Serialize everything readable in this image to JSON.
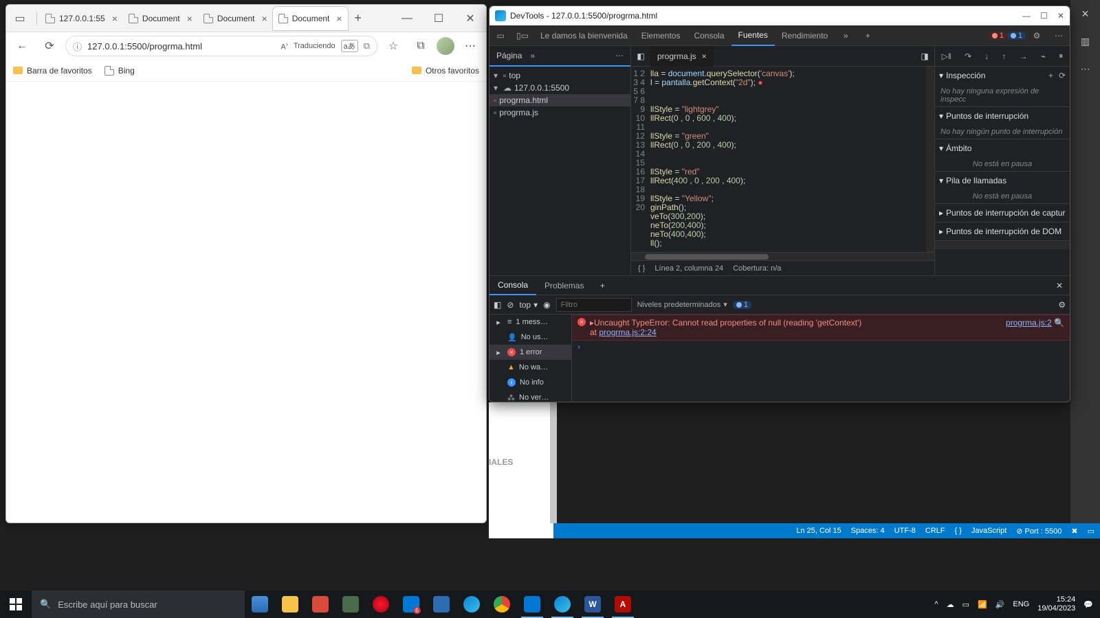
{
  "edge": {
    "tabs": [
      {
        "title": "127.0.0.1:55"
      },
      {
        "title": "Document"
      },
      {
        "title": "Document"
      },
      {
        "title": "Document"
      }
    ],
    "url": "127.0.0.1:5500/progrma.html",
    "translate": "Traduciendo",
    "favbar": {
      "title": "Barra de favoritos",
      "bing": "Bing",
      "other": "Otros favoritos"
    }
  },
  "leaked": "IALES",
  "devtools": {
    "title": "DevTools - 127.0.0.1:5500/progrma.html",
    "toptabs": {
      "welcome": "Le damos la bienvenida",
      "elements": "Elementos",
      "console": "Consola",
      "sources": "Fuentes",
      "perf": "Rendimiento"
    },
    "err_count": "1",
    "issue_count": "1",
    "leftpane": {
      "pagina": "Página",
      "top": "top",
      "host": "127.0.0.1:5500",
      "files": [
        "progrma.html",
        "progrma.js"
      ]
    },
    "src": {
      "file": "progrma.js",
      "lines": [
        "lla = document.querySelector('canvas');",
        "l = pantalla.getContext(\"2d\");",
        "",
        "",
        "llStyle = \"lightgrey\"",
        "llRect(0 , 0 , 600 , 400);",
        "",
        "llStyle = \"green\"",
        "llRect(0 , 0 , 200 , 400);",
        "",
        "",
        "llStyle = \"red\"",
        "llRect(400 , 0 , 200 , 400);",
        "",
        "llStyle = \"Yellow\";",
        "ginPath();",
        "veTo(300,200);",
        "neTo(200,400);",
        "neTo(400,400);",
        "ll();"
      ],
      "status_line": "Línea 2, columna 24",
      "coverage": "Cobertura: n/a"
    },
    "right": {
      "inspect": "Inspección",
      "inspect_empty": "No hay ninguna expresión de inspecc",
      "breakpoints": "Puntos de interrupción",
      "bp_empty": "No hay ningún punto de interrupción",
      "scope": "Ámbito",
      "scope_empty": "No está en pausa",
      "callstack": "Pila de llamadas",
      "cs_empty": "No está en pausa",
      "bp_capture": "Puntos de interrupción de captur",
      "bp_dom": "Puntos de interrupción de DOM"
    },
    "drawer": {
      "tabs": {
        "console": "Consola",
        "problems": "Problemas"
      },
      "filter_ph": "Filtro",
      "top": "top",
      "levels": "Niveles predeterminados",
      "sidebar": {
        "msgs": "1 mess…",
        "nouser": "No us…",
        "err": "1 error",
        "nowarn": "No wa…",
        "noinfo": "No info",
        "noverb": "No ver…"
      },
      "error": {
        "head": "Uncaught TypeError: Cannot read properties of null (reading 'getContext')",
        "at": "    at ",
        "at_link": "progrma.js:2:24",
        "src": "progrma.js:2"
      }
    }
  },
  "vsc": {
    "ln": "Ln 25, Col 15",
    "spaces": "Spaces: 4",
    "enc": "UTF-8",
    "eol": "CRLF",
    "lang": "JavaScript",
    "port": "Port : 5500"
  },
  "taskbar": {
    "search": "Escribe aquí para buscar",
    "tray": {
      "lang": "ENG",
      "time": "15:24",
      "date": "19/04/2023"
    }
  }
}
